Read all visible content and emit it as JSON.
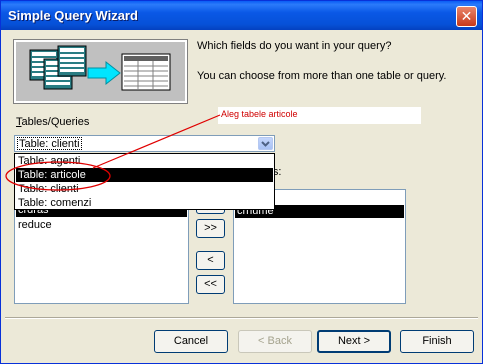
{
  "window": {
    "title": "Simple Query Wizard",
    "close_glyph": "✕"
  },
  "intro": {
    "question": "Which fields do you want in your query?",
    "hint": "You can choose from more than one table or query."
  },
  "annotation": {
    "text": "Aleg tabele articole",
    "color": "#D00000"
  },
  "tables": {
    "label_access": "T",
    "label_rest": "ables/Queries",
    "selected": "Table: clienti",
    "options": [
      "Table: agenti",
      "Table: articole",
      "Table: clienti",
      "Table: comenzi"
    ],
    "highlighted_index": 1
  },
  "available_fields": {
    "items": [
      "crdras",
      "reduce"
    ]
  },
  "selected_fields": {
    "label": "Fields:",
    "items": [
      "",
      "crnume"
    ]
  },
  "move_buttons": {
    "add_one": ">",
    "add_all": ">>",
    "remove_one": "<",
    "remove_all": "<<"
  },
  "footer": {
    "cancel": "Cancel",
    "back": "< Back",
    "next": "Next >",
    "finish": "Finish"
  },
  "colors": {
    "titlebar": "#0A58E6",
    "face": "#ECE9D8",
    "selection": "#000000"
  }
}
